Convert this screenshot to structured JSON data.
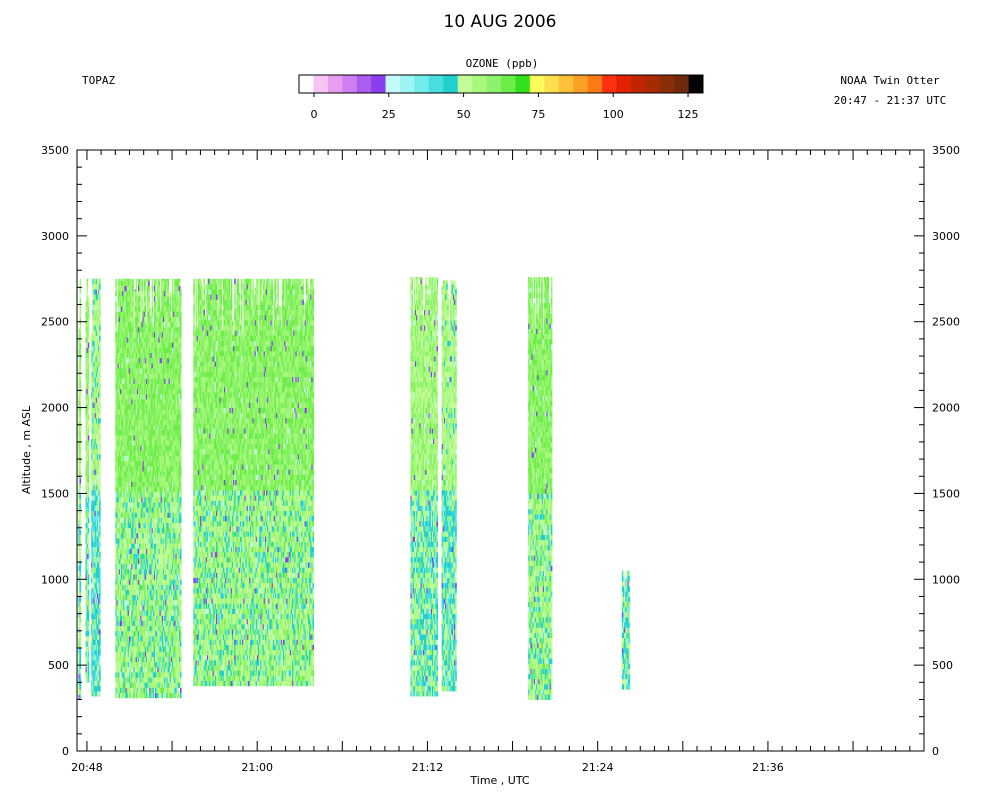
{
  "chart_data": {
    "type": "heatmap",
    "title": "10 AUG 2006",
    "left_label": "TOPAZ",
    "right_label_line1": "NOAA Twin Otter",
    "right_label_line2": "20:47 - 21:37 UTC",
    "xlabel": "Time , UTC",
    "ylabel": "Altitude , m ASL",
    "x_tick_labels": [
      "20:48",
      "21:00",
      "21:12",
      "21:24",
      "21:36"
    ],
    "x_tick_minutes": [
      48,
      60,
      72,
      84,
      96
    ],
    "xlim_minutes": [
      47.3,
      107.0
    ],
    "ylim": [
      0,
      3500
    ],
    "y_ticks": [
      0,
      500,
      1000,
      1500,
      2000,
      2500,
      3000,
      3500
    ],
    "colorbar": {
      "title": "OZONE (ppb)",
      "tick_labels": [
        "0",
        "25",
        "50",
        "75",
        "100",
        "125"
      ],
      "ticks": [
        0,
        25,
        50,
        75,
        100,
        125
      ],
      "range": [
        -5,
        130
      ],
      "colors": [
        "#ffffff",
        "#f7c4f4",
        "#e89ef0",
        "#cf7df0",
        "#a95ef0",
        "#8a3ef0",
        "#c4fcfc",
        "#9df4f4",
        "#72ebeb",
        "#48dede",
        "#22cfcf",
        "#c2fc9a",
        "#a8f87e",
        "#8cf26a",
        "#6ced48",
        "#33e01e",
        "#fcfc5c",
        "#fce050",
        "#fcc03a",
        "#fca024",
        "#fc7a14",
        "#fc3210",
        "#e02200",
        "#c22400",
        "#a82a00",
        "#8a2e0a",
        "#6e2a0a",
        "#000000"
      ]
    },
    "segments": [
      {
        "start": 47.4,
        "end": 47.55,
        "top": 2750,
        "bottom": 300,
        "base_ppb": 58
      },
      {
        "start": 47.9,
        "end": 48.1,
        "top": 2750,
        "bottom": 400,
        "base_ppb": 57
      },
      {
        "start": 48.3,
        "end": 48.9,
        "top": 2750,
        "bottom": 320,
        "base_ppb": 52
      },
      {
        "start": 50.0,
        "end": 54.6,
        "top": 2750,
        "bottom": 310,
        "base_ppb": 60
      },
      {
        "start": 55.5,
        "end": 63.9,
        "top": 2750,
        "bottom": 380,
        "base_ppb": 60
      },
      {
        "start": 70.8,
        "end": 72.7,
        "top": 2760,
        "bottom": 320,
        "base_ppb": 56
      },
      {
        "start": 73.0,
        "end": 74.0,
        "top": 2740,
        "bottom": 350,
        "base_ppb": 54
      },
      {
        "start": 79.1,
        "end": 80.7,
        "top": 2760,
        "bottom": 300,
        "base_ppb": 60
      },
      {
        "start": 85.7,
        "end": 86.2,
        "top": 1050,
        "bottom": 360,
        "base_ppb": 55
      }
    ]
  }
}
